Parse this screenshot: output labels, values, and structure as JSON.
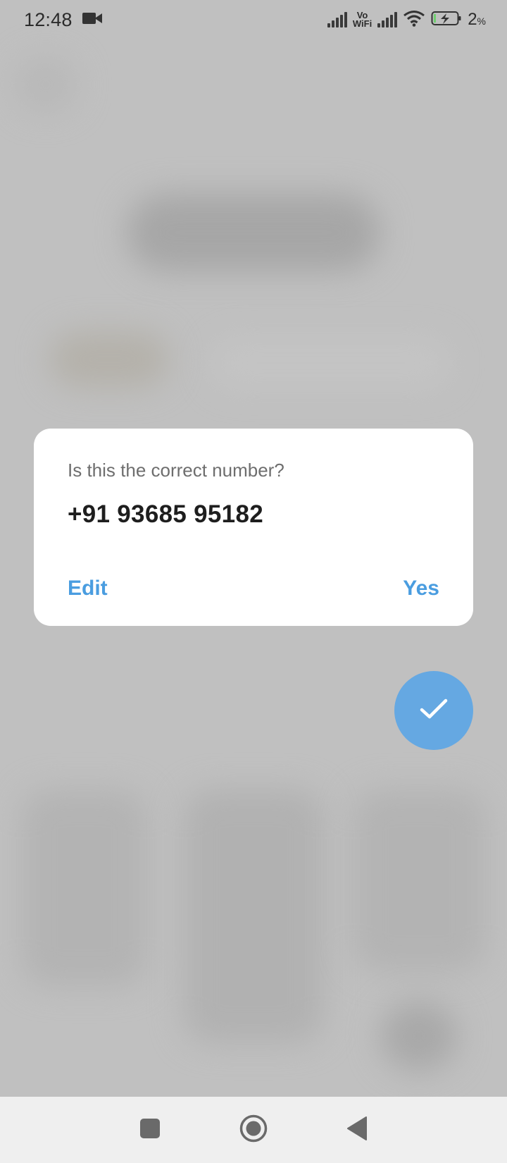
{
  "status_bar": {
    "time": "12:48",
    "vowifi_top": "Vo",
    "vowifi_bottom": "WiFi",
    "battery_percent": "2",
    "battery_unit": "%"
  },
  "dialog": {
    "question": "Is this the correct number?",
    "phone_number": "+91 93685 95182",
    "edit_label": "Edit",
    "yes_label": "Yes"
  },
  "colors": {
    "accent": "#4a9de0",
    "fab": "#65a8e2",
    "scrim": "#c0c0c0"
  },
  "icons": {
    "fab": "checkmark-icon",
    "status": [
      "video-camera-icon",
      "signal-icon",
      "wifi-icon",
      "battery-charging-icon"
    ],
    "nav": [
      "recents-square-icon",
      "home-circle-icon",
      "back-triangle-icon"
    ]
  }
}
